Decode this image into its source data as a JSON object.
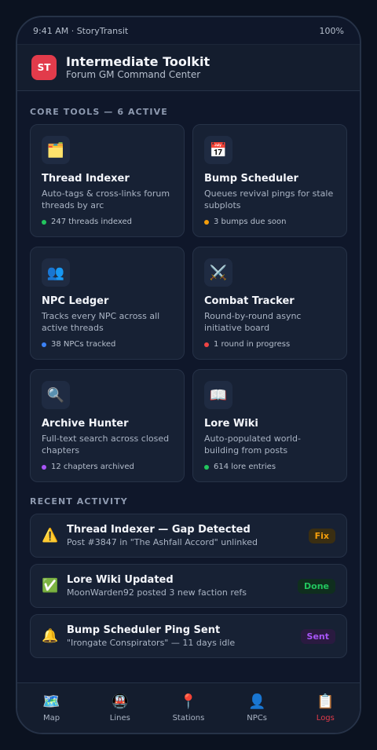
{
  "status": {
    "time_app": "9:41 AM · StoryTransit",
    "battery": "100%"
  },
  "header": {
    "logo": "ST",
    "title": "Intermediate Toolkit",
    "subtitle": "Forum GM Command Center"
  },
  "core": {
    "label": "CORE TOOLS — 6 ACTIVE",
    "tools": [
      {
        "icon": "🗂️",
        "icon_name": "folder-icon",
        "title": "Thread Indexer",
        "desc": "Auto-tags & cross-links forum threads by arc",
        "stat": "247 threads indexed",
        "dot": "#22c55e"
      },
      {
        "icon": "📅",
        "icon_name": "calendar-icon",
        "title": "Bump Scheduler",
        "desc": "Queues revival pings for stale subplots",
        "stat": "3 bumps due soon",
        "dot": "#f59e0b"
      },
      {
        "icon": "👥",
        "icon_name": "people-icon",
        "title": "NPC Ledger",
        "desc": "Tracks every NPC across all active threads",
        "stat": "38 NPCs tracked",
        "dot": "#3b82f6"
      },
      {
        "icon": "⚔️",
        "icon_name": "crossed-swords-icon",
        "title": "Combat Tracker",
        "desc": "Round-by-round async initiative board",
        "stat": "1 round in progress",
        "dot": "#ef4444"
      },
      {
        "icon": "🔍",
        "icon_name": "magnifier-icon",
        "title": "Archive Hunter",
        "desc": "Full-text search across closed chapters",
        "stat": "12 chapters archived",
        "dot": "#a855f7"
      },
      {
        "icon": "📖",
        "icon_name": "book-icon",
        "title": "Lore Wiki",
        "desc": "Auto-populated world-building from posts",
        "stat": "614 lore entries",
        "dot": "#22c55e"
      }
    ]
  },
  "recent": {
    "label": "RECENT ACTIVITY",
    "items": [
      {
        "icon": "⚠️",
        "icon_name": "warning-icon",
        "title": "Thread Indexer — Gap Detected",
        "sub": "Post #3847 in \"The Ashfall Accord\" unlinked",
        "action": "Fix",
        "action_color": "#f59e0b",
        "action_bg": "#3a2e12"
      },
      {
        "icon": "✅",
        "icon_name": "check-icon",
        "title": "Lore Wiki Updated",
        "sub": "MoonWarden92 posted 3 new faction refs",
        "action": "Done",
        "action_color": "#22c55e",
        "action_bg": "#0f2e1e"
      },
      {
        "icon": "🔔",
        "icon_name": "bell-icon",
        "title": "Bump Scheduler Ping Sent",
        "sub": "\"Irongate Conspirators\" — 11 days idle",
        "action": "Sent",
        "action_color": "#a855f7",
        "action_bg": "#2a1a40"
      }
    ]
  },
  "tabs": [
    {
      "icon": "🗺️",
      "icon_name": "map-icon",
      "label": "Map"
    },
    {
      "icon": "🚇",
      "icon_name": "metro-icon",
      "label": "Lines"
    },
    {
      "icon": "📍",
      "icon_name": "pin-icon",
      "label": "Stations"
    },
    {
      "icon": "👤",
      "icon_name": "person-icon",
      "label": "NPCs"
    },
    {
      "icon": "📋",
      "icon_name": "clipboard-icon",
      "label": "Logs",
      "active": true
    }
  ]
}
